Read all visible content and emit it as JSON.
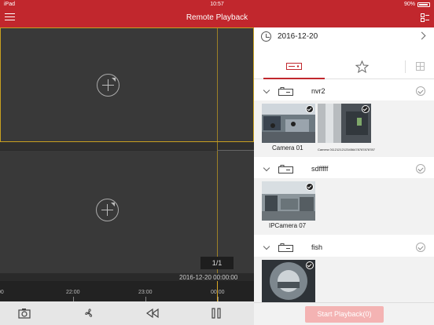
{
  "statusbar": {
    "device": "iPad",
    "time": "10:57",
    "battery": "90%"
  },
  "nav": {
    "title": "Remote Playback"
  },
  "player": {
    "page_indicator": "1/1",
    "timestamp": "2016-12-20  00:00:00",
    "timeline_labels": [
      "00",
      "22:00",
      "23:00",
      "00:00"
    ]
  },
  "toolbar": {
    "tools": [
      "camera-icon",
      "fan-icon",
      "rewind-icon",
      "pause-icon"
    ]
  },
  "panel": {
    "date": "2016-12-20",
    "groups": [
      {
        "name": "nvr2",
        "cameras": [
          {
            "name": "Camera 01"
          },
          {
            "name": "Camera 01121212123456478787878787"
          }
        ]
      },
      {
        "name": "sdfffff",
        "cameras": [
          {
            "name": "IPCamera 07"
          }
        ]
      },
      {
        "name": "fish",
        "cameras": [
          {
            "name": ""
          }
        ]
      }
    ],
    "start_button": "Start Playback(0)"
  },
  "colors": {
    "brand": "#c1272d",
    "accent": "#c8a020",
    "start_button": "#f4b3b3"
  }
}
